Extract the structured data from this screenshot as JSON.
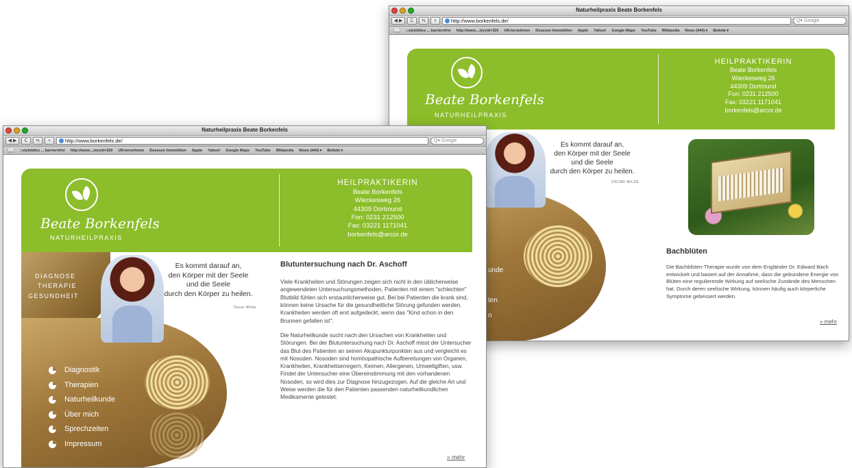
{
  "browser": {
    "window_title": "Naturheilpraxis Beate Borkenfels",
    "url": "http://www.borkenfels.de/",
    "search_placeholder": "Google",
    "bookmarks": [
      "::stylebites ... barrierefrei",
      "http://www....toryid=320",
      "UN-ternehmen",
      "Deussen Immobilien",
      "Apple",
      "Yahoo!",
      "Google Maps",
      "YouTube",
      "Wikipedia",
      "News (444) ▾",
      "Beliebt ▾"
    ]
  },
  "site": {
    "signature": "Beate Borkenfels",
    "subtitle": "Naturheilpraxis",
    "contact": {
      "title": "HEILPRAKTIKERIN",
      "name": "Beate Borkenfels",
      "street": "Wieckesweg 26",
      "city": "44309 Dortmund",
      "phone": "Fon:  0231  212500",
      "fax": "Fax: 03221 1171041",
      "email": "borkenfels@arcor.de"
    },
    "quote": {
      "line1": "Es kommt darauf an,",
      "line2": "den Körper mit der Seele",
      "line3": "und die Seele",
      "line4": "durch den Körper zu heilen.",
      "author": "Oscar Wilde"
    },
    "left_nav": [
      "Diagnose",
      "Therapie",
      "Gesundheit"
    ],
    "menu": [
      "Diagnostik",
      "Therapien",
      "Naturheilkunde",
      "Über mich",
      "Sprechzeiten",
      "Impressum"
    ],
    "article": {
      "title": "Blutuntersuchung nach Dr. Aschoff",
      "p1": "Viele Krankheiten und Störungen zeigen sich nicht in den üblicherweise angewendeten Untersuchungsmethoden. Patienten mit einem \"schlechten\" Blutbild fühlen sich erstaunlicherweise gut. Bei bei Patienten die krank sind, können keine Ursache für die gesundheitliche Störung gefunden werden. Krankheiten werden oft erst aufgedeckt, wenn das \"Kind schon in den Brunnen gefallen ist\".",
      "p2": "Die Naturheilkunde sucht nach den Ursachen von Krankheiten und Störungen. Bei der Blutuntersuchung nach Dr. Aschoff misst der Untersucher das Blut des Patienten an seinen Akupunkturpunkten aus und vergleicht es mit Nosoden. Nosoden sind homöopathische Aufbereitungen von Organen, Krankheiten, Krankheitserregern, Keimen, Allergenen, Umweltgiften, usw. Findet der Untersucher eine Übereinstimmung mit den vorhandenen Nosoden, so wird dies zur Diagnose hinzugezogen. Auf die gleiche Art und Weise werden die für den Patienten passenden naturheilkundlichen Medikamente getestet.",
      "more": "» mehr"
    },
    "article2": {
      "title": "Bachblüten",
      "p1": "Die Bachblüten-Therapie wurde von dem Engländer Dr. Edward Bach entwickelt und basiert auf der Annahme, dass die gebundene Energie von Blüten eine regulierende Wirkung auf seelische Zustände des Menschen hat. Durch deren seelische Wirkung, können häufig auch körperliche Symptome gebessert werden.",
      "more": "» mehr"
    },
    "back_partial_menu": [
      "unde",
      "ten",
      "n"
    ]
  }
}
